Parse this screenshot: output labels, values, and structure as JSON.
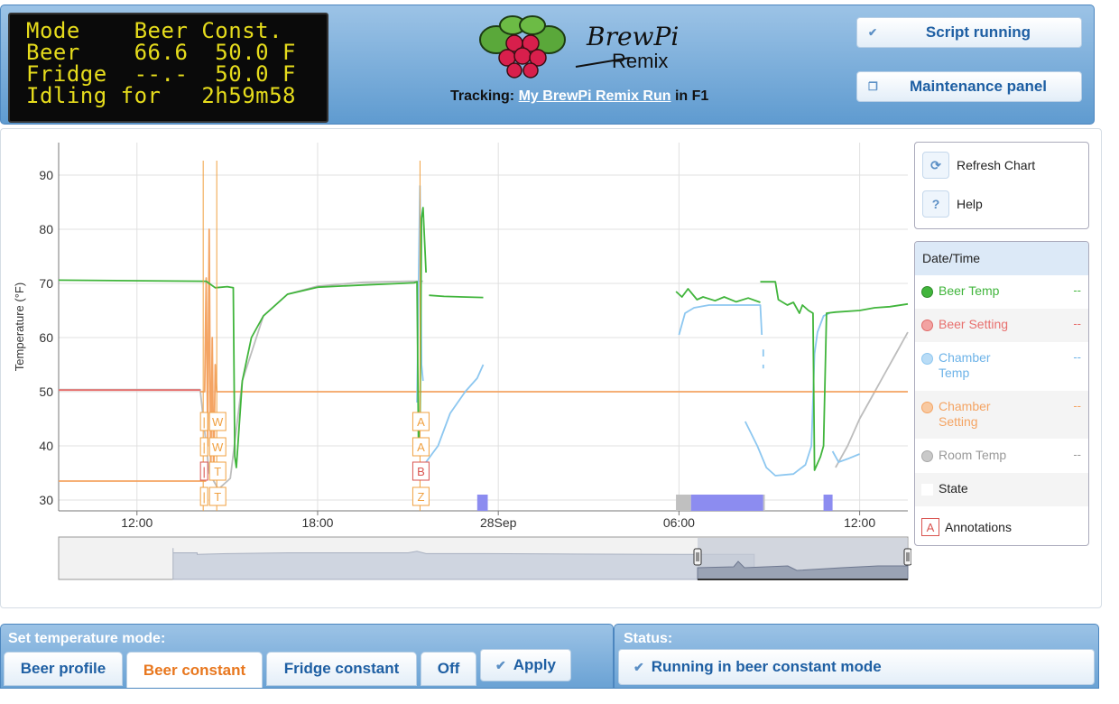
{
  "lcd": {
    "line1": "Mode    Beer Const.",
    "line2": "Beer    66.6  50.0 F",
    "line3": "Fridge  --.-  50.0 F",
    "line4": "Idling for   2h59m58"
  },
  "header": {
    "logo_title": "BrewPi",
    "logo_subtitle": "Remix",
    "tracking_label": "Tracking:",
    "tracking_link": "My BrewPi Remix Run",
    "tracking_suffix": "in F1",
    "script_button": "Script running",
    "maintenance_button": "Maintenance panel"
  },
  "tools": {
    "refresh": "Refresh Chart",
    "help": "Help"
  },
  "legend": {
    "header": "Date/Time",
    "items": [
      {
        "name": "Beer Temp",
        "value": "--",
        "color": "#41b53c"
      },
      {
        "name": "Beer Setting",
        "value": "--",
        "color": "#e8706e"
      },
      {
        "name": "Chamber Temp",
        "value": "--",
        "color": "#8dc7f0"
      },
      {
        "name": "Chamber Setting",
        "value": "--",
        "color": "#f4a463"
      },
      {
        "name": "Room Temp",
        "value": "--",
        "color": "#b8b8b8"
      },
      {
        "name": "State",
        "value": "",
        "color": "#ffffff"
      },
      {
        "name": "Annotations",
        "value": "",
        "color": "#d9534f"
      }
    ]
  },
  "chart_data": {
    "type": "line",
    "ylabel": "Temperature (°F)",
    "ylim": [
      28,
      96
    ],
    "yticks": [
      30,
      40,
      50,
      60,
      70,
      80,
      90
    ],
    "xticks": [
      {
        "label": "12:00",
        "t": 12
      },
      {
        "label": "18:00",
        "t": 18
      },
      {
        "label": "28Sep",
        "t": 24
      },
      {
        "label": "06:00",
        "t": 30
      },
      {
        "label": "12:00",
        "t": 36
      }
    ],
    "xlim": [
      9.4,
      37.6
    ],
    "series": [
      {
        "name": "Room Temp",
        "color": "#bdbdbd",
        "segments": [
          [
            [
              9.4,
              50.4
            ],
            [
              14.1,
              50.4
            ],
            [
              14.4,
              35
            ],
            [
              14.7,
              32
            ],
            [
              15.1,
              34
            ],
            [
              15.5,
              52
            ],
            [
              16.2,
              64
            ],
            [
              17,
              68
            ],
            [
              18,
              69.5
            ],
            [
              19.5,
              70.2
            ],
            [
              21,
              70.4
            ],
            [
              21.5,
              70.4
            ]
          ],
          [
            [
              35.2,
              36
            ],
            [
              35.6,
              40
            ],
            [
              36,
              45
            ],
            [
              36.4,
              49
            ],
            [
              36.8,
              53
            ],
            [
              37.2,
              57
            ],
            [
              37.6,
              61
            ]
          ]
        ]
      },
      {
        "name": "Chamber Setting",
        "color": "#f4a463",
        "segments": [
          [
            [
              9.4,
              33.5
            ],
            [
              14.3,
              33.5
            ]
          ],
          [
            [
              14.1,
              50
            ],
            [
              14.25,
              50
            ],
            [
              14.3,
              71
            ],
            [
              14.35,
              40
            ],
            [
              14.4,
              80
            ],
            [
              14.45,
              34
            ],
            [
              14.5,
              60
            ],
            [
              14.55,
              34
            ],
            [
              14.6,
              55
            ],
            [
              14.65,
              50
            ],
            [
              37.6,
              50
            ]
          ]
        ]
      },
      {
        "name": "Beer Setting",
        "color": "#e8706e",
        "segments": [
          [
            [
              9.4,
              50.3
            ],
            [
              14.1,
              50.3
            ]
          ]
        ]
      },
      {
        "name": "Chamber Temp",
        "color": "#8dc7f0",
        "segments": [
          [
            [
              21.3,
              48
            ],
            [
              21.35,
              70
            ],
            [
              21.4,
              88
            ],
            [
              21.45,
              55
            ],
            [
              21.5,
              52
            ]
          ],
          [
            [
              21.6,
              37
            ],
            [
              22,
              40
            ],
            [
              22.4,
              46
            ],
            [
              22.9,
              50
            ],
            [
              23.3,
              52.5
            ],
            [
              23.5,
              55
            ]
          ],
          [
            [
              30.0,
              60.5
            ],
            [
              30.2,
              64.5
            ],
            [
              30.5,
              65.5
            ],
            [
              31,
              66
            ],
            [
              32,
              66
            ],
            [
              32.7,
              66
            ],
            [
              32.75,
              60.5
            ]
          ],
          [
            [
              32.8,
              57.8
            ],
            [
              32.8,
              56.5
            ]
          ],
          [
            [
              32.8,
              55
            ],
            [
              32.8,
              54.3
            ]
          ],
          [
            [
              32.2,
              44.5
            ],
            [
              32.6,
              40
            ],
            [
              32.9,
              36
            ],
            [
              33.2,
              34.5
            ],
            [
              33.8,
              34.8
            ],
            [
              34.2,
              36.5
            ],
            [
              34.4,
              40
            ],
            [
              34.5,
              57
            ],
            [
              34.6,
              61
            ],
            [
              34.8,
              64
            ],
            [
              35,
              64.5
            ]
          ],
          [
            [
              35.1,
              39
            ],
            [
              35.3,
              37
            ],
            [
              35.6,
              37.6
            ],
            [
              36,
              38.5
            ]
          ]
        ]
      },
      {
        "name": "Beer Temp",
        "color": "#41b53c",
        "segments": [
          [
            [
              9.4,
              70.6
            ],
            [
              14.3,
              70.4
            ],
            [
              14.6,
              69.2
            ],
            [
              15.0,
              69.4
            ],
            [
              15.2,
              69.2
            ],
            [
              15.25,
              38
            ],
            [
              15.3,
              36
            ],
            [
              15.5,
              52
            ],
            [
              15.8,
              60
            ],
            [
              16.2,
              64
            ],
            [
              17,
              68
            ],
            [
              18,
              69.3
            ],
            [
              19.5,
              69.7
            ],
            [
              21.2,
              70.1
            ],
            [
              21.3,
              70.3
            ],
            [
              21.35,
              39
            ],
            [
              21.4,
              44
            ],
            [
              21.45,
              82
            ],
            [
              21.5,
              84
            ],
            [
              21.6,
              72
            ]
          ],
          [
            [
              21.7,
              67.8
            ],
            [
              22.2,
              67.6
            ],
            [
              22.8,
              67.5
            ],
            [
              23.5,
              67.4
            ]
          ],
          [
            [
              29.9,
              68.5
            ],
            [
              30.1,
              67.5
            ],
            [
              30.3,
              69
            ],
            [
              30.6,
              67
            ],
            [
              30.8,
              67.5
            ],
            [
              31.2,
              66.8
            ],
            [
              31.5,
              67.5
            ],
            [
              31.9,
              66.6
            ],
            [
              32.3,
              67.3
            ],
            [
              32.7,
              66.5
            ]
          ],
          [
            [
              32.7,
              70.3
            ],
            [
              33.2,
              70.3
            ],
            [
              33.3,
              67
            ],
            [
              33.6,
              66
            ],
            [
              33.8,
              66.5
            ],
            [
              34.0,
              64.5
            ],
            [
              34.1,
              66
            ],
            [
              34.3,
              65
            ],
            [
              34.45,
              64.5
            ],
            [
              34.5,
              35.5
            ],
            [
              34.7,
              38
            ],
            [
              34.8,
              40
            ],
            [
              34.9,
              64.5
            ],
            [
              35.2,
              64.7
            ],
            [
              36,
              65
            ],
            [
              36.5,
              65.5
            ],
            [
              37,
              65.7
            ],
            [
              37.6,
              66.2
            ]
          ]
        ]
      }
    ],
    "state_blocks": [
      {
        "start": 23.3,
        "end": 23.65,
        "color": "#8c8cf0"
      },
      {
        "start": 29.9,
        "end": 30.4,
        "color": "#c0c0c0"
      },
      {
        "start": 30.4,
        "end": 32.8,
        "color": "#8c8cf0"
      },
      {
        "start": 32.8,
        "end": 32.85,
        "color": "#c0c0c0"
      },
      {
        "start": 34.8,
        "end": 35.1,
        "color": "#8c8cf0"
      }
    ],
    "annotation_columns": [
      {
        "t": 14.2,
        "labels": [
          {
            "text": "|",
            "color": "#f0a040"
          },
          {
            "text": "|",
            "color": "#f0a040"
          },
          {
            "text": "|",
            "color": "#d9534f"
          },
          {
            "text": "|",
            "color": "#f0a040"
          }
        ]
      },
      {
        "t": 14.65,
        "labels": [
          {
            "text": "W",
            "color": "#f0a040"
          },
          {
            "text": "W",
            "color": "#f0a040"
          },
          {
            "text": "T",
            "color": "#f0a040"
          },
          {
            "text": "T",
            "color": "#f0a040"
          }
        ]
      },
      {
        "t": 21.4,
        "labels": [
          {
            "text": "A",
            "color": "#f0a040"
          },
          {
            "text": "A",
            "color": "#f0a040"
          },
          {
            "text": "B",
            "color": "#d9534f"
          },
          {
            "text": "Z",
            "color": "#f0a040"
          }
        ]
      }
    ]
  },
  "mode": {
    "title": "Set temperature mode:",
    "tabs": [
      "Beer profile",
      "Beer constant",
      "Fridge constant",
      "Off"
    ],
    "active_tab": "Beer constant",
    "apply": "Apply"
  },
  "status": {
    "title": "Status:",
    "text": "Running in beer constant mode"
  }
}
